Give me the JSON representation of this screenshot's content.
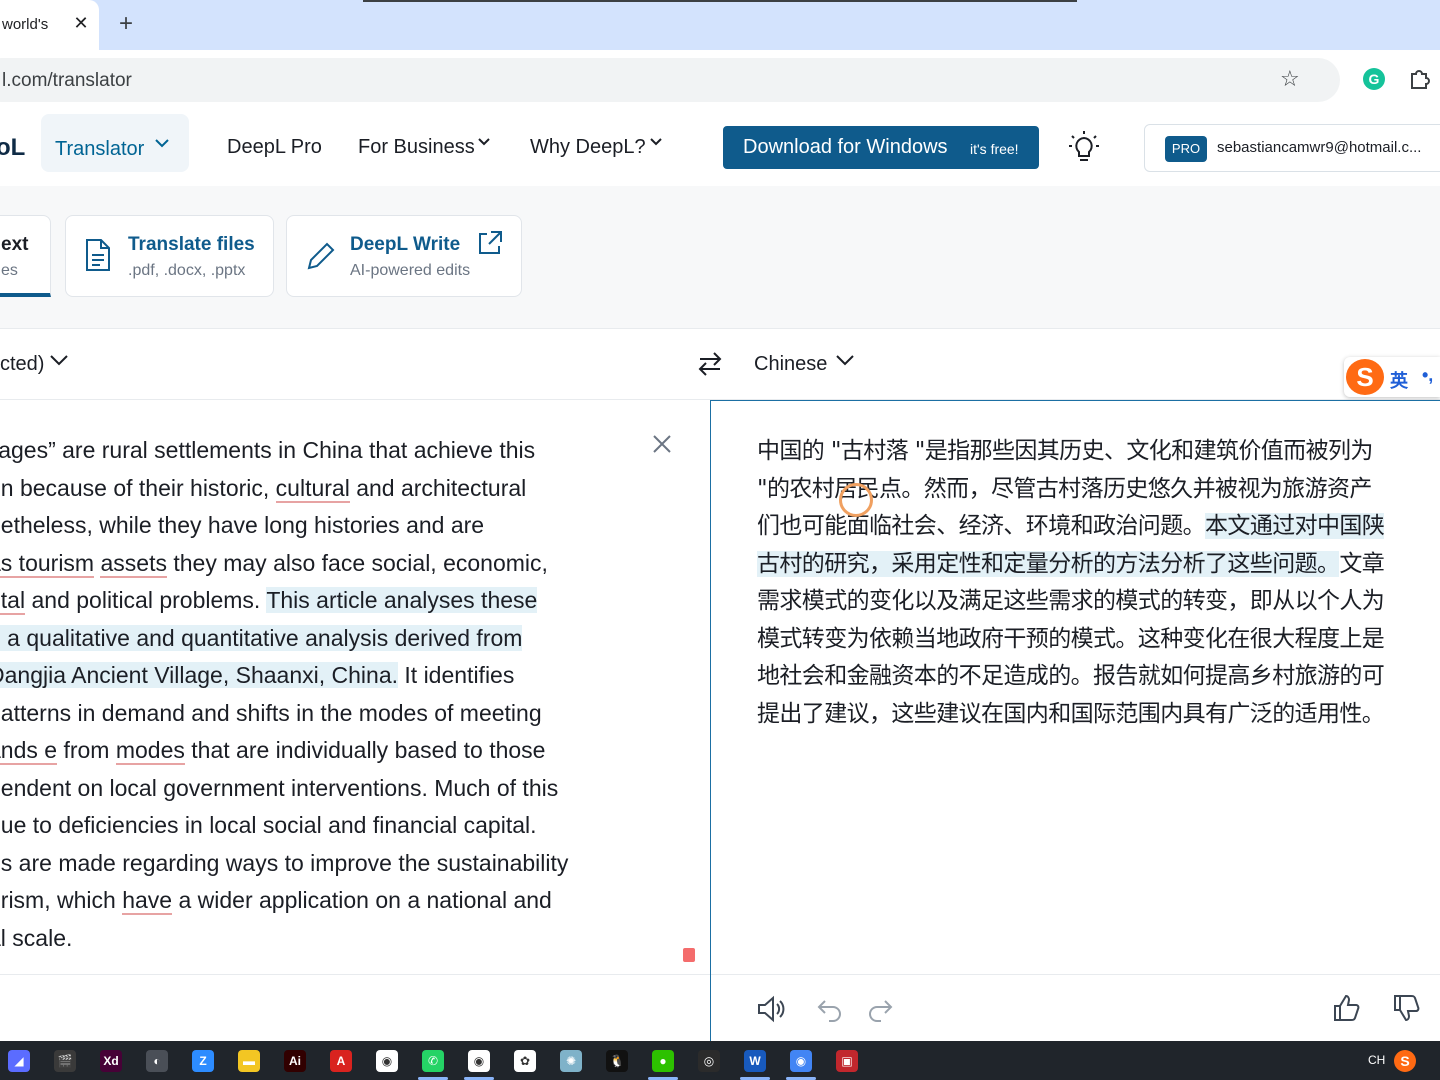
{
  "browser": {
    "tab_title": "world's",
    "tab_close": "✕",
    "new_tab": "+",
    "url": "l.com/translator"
  },
  "header": {
    "logo": "oL",
    "nav": {
      "translator": "Translator",
      "deepl_pro": "DeepL Pro",
      "for_business": "For Business",
      "why_deepl": "Why DeepL?"
    },
    "download": {
      "label": "Download for Windows",
      "note": "it's free!"
    },
    "account": {
      "badge": "PRO",
      "email": "sebastiancamwr9@hotmail.c..."
    }
  },
  "modes": {
    "text": {
      "title": "ext",
      "sub": "es"
    },
    "files": {
      "title": "Translate files",
      "sub": ".pdf, .docx, .pptx"
    },
    "write": {
      "title": "DeepL Write",
      "sub": "AI-powered edits"
    }
  },
  "languages": {
    "source": "cted)",
    "target": "Chinese",
    "ime": {
      "logo": "S",
      "mode": "英",
      "punct": "•,"
    }
  },
  "source": {
    "lines": [
      [
        {
          "t": "llages” are rural settlements in China that achieve this"
        }
      ],
      [
        {
          "t": "on because of their historic, "
        },
        {
          "t": "cultural",
          "u": true
        },
        {
          "t": " and architectural"
        }
      ],
      [
        {
          "t": "netheless, while they have long histories and are"
        }
      ],
      [
        {
          "t": " "
        },
        {
          "t": "as tourism",
          "u": true
        },
        {
          "t": " "
        },
        {
          "t": "assets",
          "u": true
        },
        {
          "t": " they may also face social, economic,"
        }
      ],
      [
        {
          "t": "ntal",
          "u": true
        },
        {
          "t": " and political problems. "
        },
        {
          "t": "This article analyses these",
          "h": true
        }
      ],
      [
        {
          "t": "g a qualitative and quantitative analysis derived from",
          "h": true
        }
      ],
      [
        {
          "t": " Dangjia Ancient Village, Shaanxi, China.",
          "h": true
        },
        {
          "t": " It identifies"
        }
      ],
      [
        {
          "t": "patterns in demand and shifts in the modes of meeting"
        }
      ],
      [
        {
          "t": "ands e",
          "u": true
        },
        {
          "t": " from "
        },
        {
          "t": "modes",
          "u": true
        },
        {
          "t": " that are individually based to those"
        }
      ],
      [
        {
          "t": "pendent on local government interventions. Much of this"
        }
      ],
      [
        {
          "t": "due to deficiencies in local social and financial capital."
        }
      ],
      [
        {
          "t": "ns are made regarding ways to improve the sustainability"
        }
      ],
      [
        {
          "t": "urism, which "
        },
        {
          "t": "have",
          "u": true
        },
        {
          "t": " a wider application on a national and"
        }
      ],
      [
        {
          "t": "al scale."
        }
      ]
    ]
  },
  "target": {
    "lines": [
      [
        {
          "t": "中国的 \"古村落 \"是指那些因其历史、文化和建筑价值而被列为"
        }
      ],
      [
        {
          "t": "\"的农村居民点。然而，尽管古村落历史悠久并被视为旅游资产"
        }
      ],
      [
        {
          "t": "们也可能面临社会、经济、环境和政治问题。"
        },
        {
          "t": "本文通过对中国陕",
          "h": true
        }
      ],
      [
        {
          "t": "古村的研究，采用定性和定量分析的方法分析了这些问题。",
          "h": true
        },
        {
          "t": "文章"
        }
      ],
      [
        {
          "t": "需求模式的变化以及满足这些需求的模式的转变，即从以个人为"
        }
      ],
      [
        {
          "t": "模式转变为依赖当地政府干预的模式。这种变化在很大程度上是"
        }
      ],
      [
        {
          "t": "地社会和金融资本的不足造成的。报告就如何提高乡村旅游的可"
        }
      ],
      [
        {
          "t": "提出了建议，这些建议在国内和国际范围内具有广泛的适用性。"
        }
      ]
    ]
  },
  "taskbar": {
    "icons": [
      "windows-start",
      "clapper-app",
      "adobe-xd",
      "pinned-app",
      "zoom",
      "file-explorer",
      "illustrator",
      "acrobat",
      "chrome",
      "whatsapp",
      "chrome-profile",
      "app-store",
      "browser-app",
      "qq",
      "wechat",
      "media-app",
      "word",
      "chrome-active",
      "pdf-app"
    ],
    "lang": "CH",
    "ime": "S"
  }
}
